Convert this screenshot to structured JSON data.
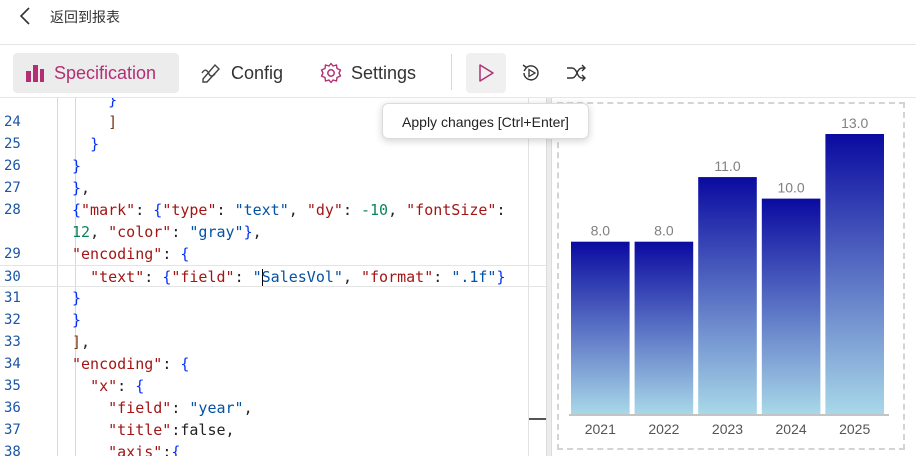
{
  "header": {
    "back_label": "返回到报表"
  },
  "toolbar": {
    "tabs": [
      {
        "label": "Specification",
        "icon": "bar-chart-icon",
        "active": true
      },
      {
        "label": "Config",
        "icon": "pen-ruler-icon",
        "active": false
      },
      {
        "label": "Settings",
        "icon": "gear-icon",
        "active": false
      }
    ],
    "actions": [
      "play-icon",
      "replay-icon",
      "shuffle-icon"
    ]
  },
  "tooltip": {
    "text": "Apply changes [Ctrl+Enter]"
  },
  "editor": {
    "cursor_line": "30",
    "lines": [
      {
        "no": "",
        "code": "    }"
      },
      {
        "no": "24",
        "code": "    ]"
      },
      {
        "no": "25",
        "code": "  }"
      },
      {
        "no": "26",
        "code": "}"
      },
      {
        "no": "27",
        "code": "},"
      },
      {
        "no": "28",
        "code": "{\"mark\": {\"type\": \"text\", \"dy\": -10, \"fontSize\":"
      },
      {
        "no": "",
        "code": "12, \"color\": \"gray\"},"
      },
      {
        "no": "29",
        "code": "\"encoding\": {"
      },
      {
        "no": "30",
        "code": "  \"text\": {\"field\": \"SalesVol\", \"format\": \".1f\"}"
      },
      {
        "no": "31",
        "code": "}"
      },
      {
        "no": "32",
        "code": "}"
      },
      {
        "no": "33",
        "code": "],"
      },
      {
        "no": "34",
        "code": "\"encoding\": {"
      },
      {
        "no": "35",
        "code": "  \"x\": {"
      },
      {
        "no": "36",
        "code": "    \"field\": \"year\","
      },
      {
        "no": "37",
        "code": "    \"title\":false,"
      },
      {
        "no": "38",
        "code": "    \"axis\":{"
      }
    ]
  },
  "chart_data": {
    "type": "bar",
    "categories": [
      "2021",
      "2022",
      "2023",
      "2024",
      "2025"
    ],
    "values": [
      8.0,
      8.0,
      11.0,
      10.0,
      13.0
    ],
    "labels": [
      "8.0",
      "8.0",
      "11.0",
      "10.0",
      "13.0"
    ],
    "xlabel": "",
    "ylabel": "",
    "ylim": [
      0,
      13
    ],
    "grid": false,
    "bar_gradient": [
      "#0a0aa0",
      "#a8d8e8"
    ],
    "label_color": "#808080"
  }
}
